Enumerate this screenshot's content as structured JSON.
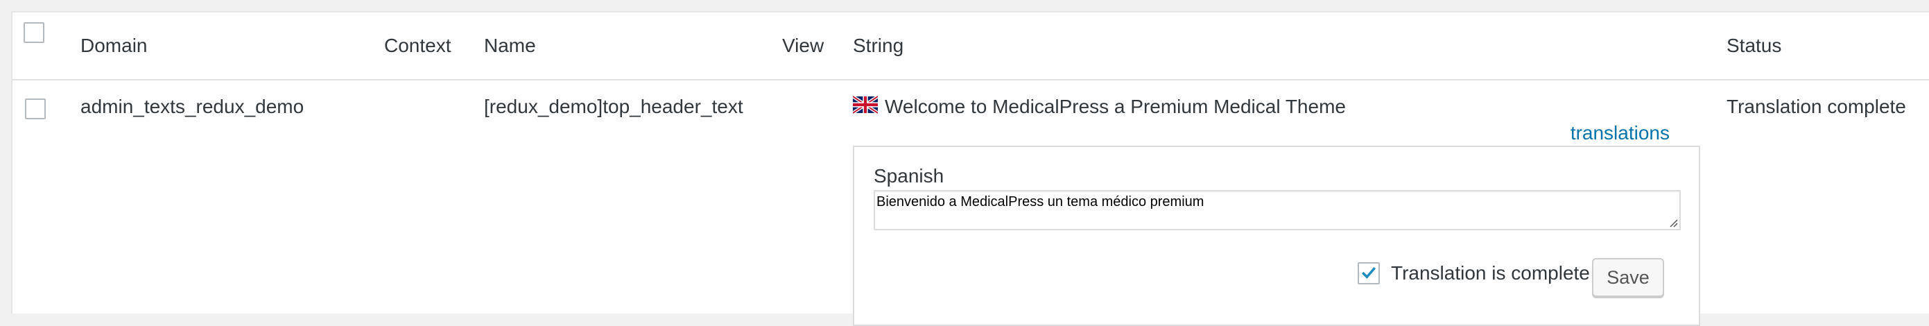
{
  "columns": {
    "domain": "Domain",
    "context": "Context",
    "name": "Name",
    "view": "View",
    "string": "String",
    "status": "Status"
  },
  "row": {
    "domain": "admin_texts_redux_demo",
    "context": "",
    "name": "[redux_demo]top_header_text",
    "view": "",
    "string": "Welcome to MedicalPress a Premium Medical Theme",
    "flag_icon": "uk-flag-icon",
    "translations_link": "translations",
    "status": "Translation complete",
    "translation_panel": {
      "language": "Spanish",
      "value": "Bienvenido a MedicalPress un tema médico premium",
      "complete_label": "Translation is complete",
      "complete_checked": true,
      "save_label": "Save"
    }
  },
  "colors": {
    "link": "#0073aa",
    "checkmark": "#1e8cbe",
    "background": "#f1f1f1"
  }
}
